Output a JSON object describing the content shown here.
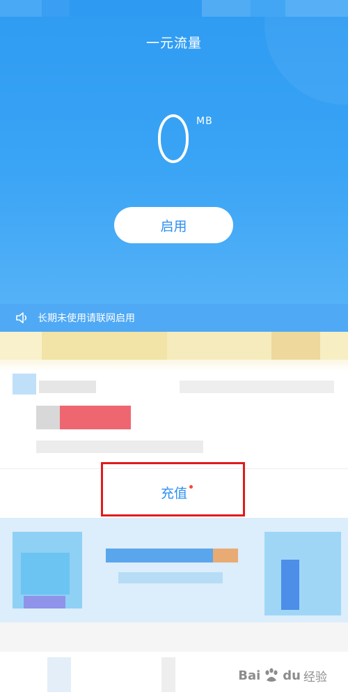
{
  "header": {
    "title": "一元流量",
    "data_value": "0",
    "data_unit": "MB",
    "enable_label": "启用"
  },
  "notice": {
    "text": "长期未使用请联网启用",
    "icon": "speaker-icon"
  },
  "recharge": {
    "label": "充值",
    "dot_color": "#f34a35"
  },
  "watermark": {
    "brand_left": "Bai",
    "brand_right": "du",
    "suffix": "经验"
  },
  "colors": {
    "hero_blue": "#2e9bf2",
    "accent_blue": "#2d8ff0",
    "highlight_red": "#e01b1b"
  }
}
